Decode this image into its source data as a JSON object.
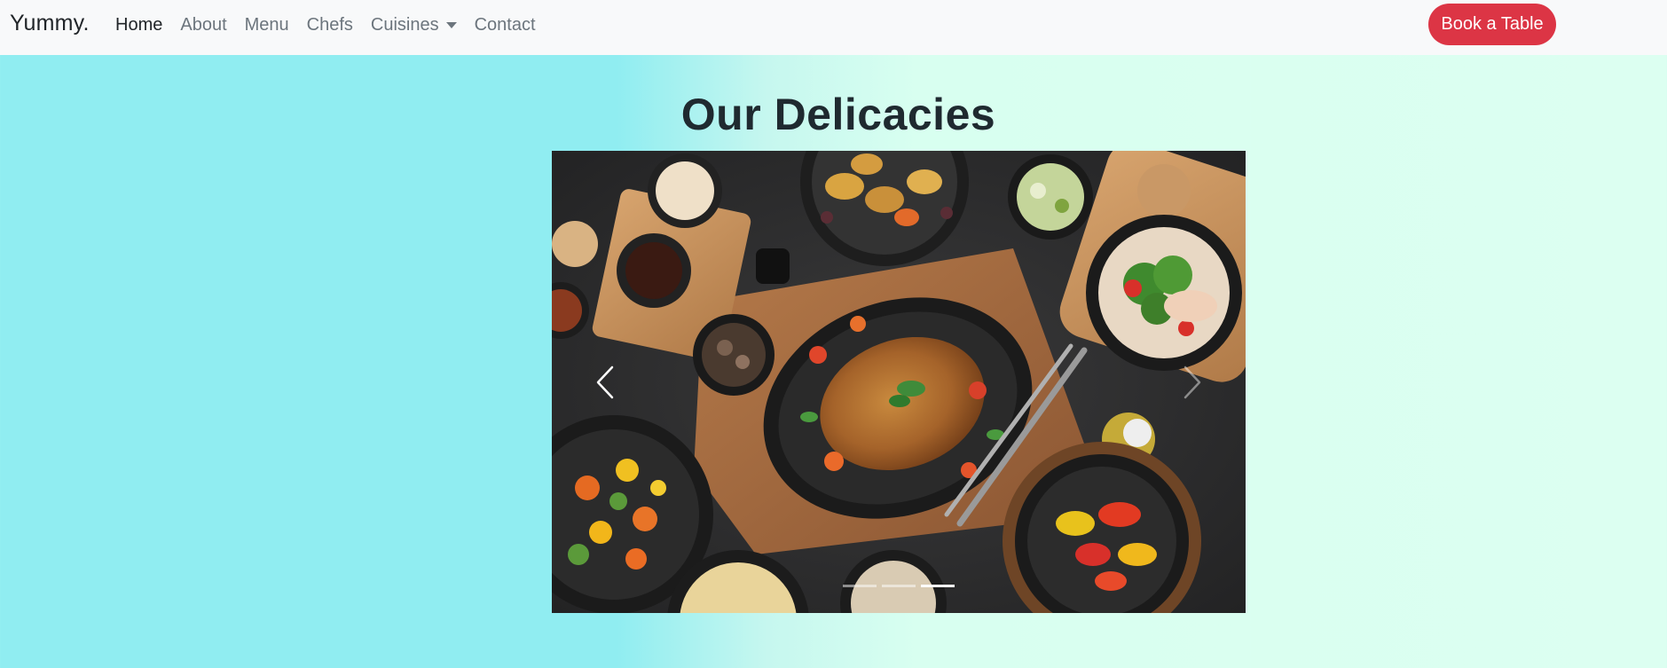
{
  "navbar": {
    "brand": "Yummy.",
    "links": [
      {
        "label": "Home",
        "active": true
      },
      {
        "label": "About",
        "active": false
      },
      {
        "label": "Menu",
        "active": false
      },
      {
        "label": "Chefs",
        "active": false
      },
      {
        "label": "Cuisines",
        "active": false,
        "dropdown": true
      },
      {
        "label": "Contact",
        "active": false
      }
    ],
    "cta_label": "Book a Table"
  },
  "section": {
    "title": "Our Delicacies"
  },
  "carousel": {
    "prev_icon": "chevron-left-icon",
    "next_icon": "chevron-right-icon",
    "indicator_count": 3,
    "active_index": 2
  },
  "colors": {
    "navbar_bg": "#f8f9fa",
    "cta_bg": "#dc3545",
    "bg_left": "#90edf1",
    "bg_right": "#dcfff1",
    "title": "#1f2a30"
  }
}
